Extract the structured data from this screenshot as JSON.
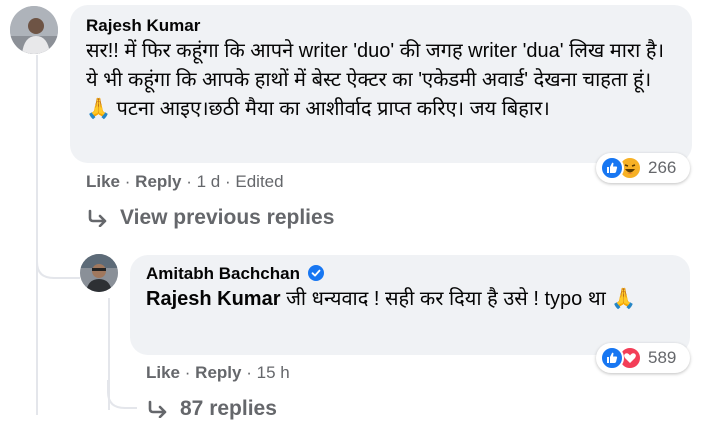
{
  "comment": {
    "author": "Rajesh Kumar",
    "text": "सर!! में फिर कहूंगा कि आपने writer 'duo' की जगह writer 'dua' लिख मारा है। ये भी कहूंगा कि आपके हाथों में बेस्ट ऐक्टर का 'एकेडमी अवार्ड' देखना चाहता हूं। 🙏 पटना आइए।छठी मैया का आशीर्वाद प्राप्त करिए। जय बिहार।",
    "actions": {
      "like": "Like",
      "reply": "Reply",
      "time": "1 d",
      "edited": "Edited",
      "sep": "·"
    },
    "reactions": {
      "icons": [
        "like-icon",
        "haha-icon"
      ],
      "count": "266"
    }
  },
  "view_previous": {
    "label": "View previous replies",
    "icon": "reply-arrow-icon"
  },
  "reply": {
    "author": "Amitabh Bachchan",
    "verified_icon": "verified-badge-icon",
    "mention": "Rajesh Kumar",
    "text": "जी धन्यवाद ! सही कर दिया है उसे ! typo था 🙏",
    "actions": {
      "like": "Like",
      "reply": "Reply",
      "time": "15 h",
      "sep": "·"
    },
    "reactions": {
      "icons": [
        "like-icon",
        "love-icon"
      ],
      "count": "589"
    }
  },
  "replies_link": {
    "label": "87 replies",
    "icon": "reply-arrow-icon"
  },
  "colors": {
    "bubble": "#f0f2f5",
    "meta": "#65676b",
    "like_blue": "#1877f2",
    "love_red": "#f33e58",
    "haha_yellow": "#f7b125",
    "verified": "#1877f2"
  }
}
